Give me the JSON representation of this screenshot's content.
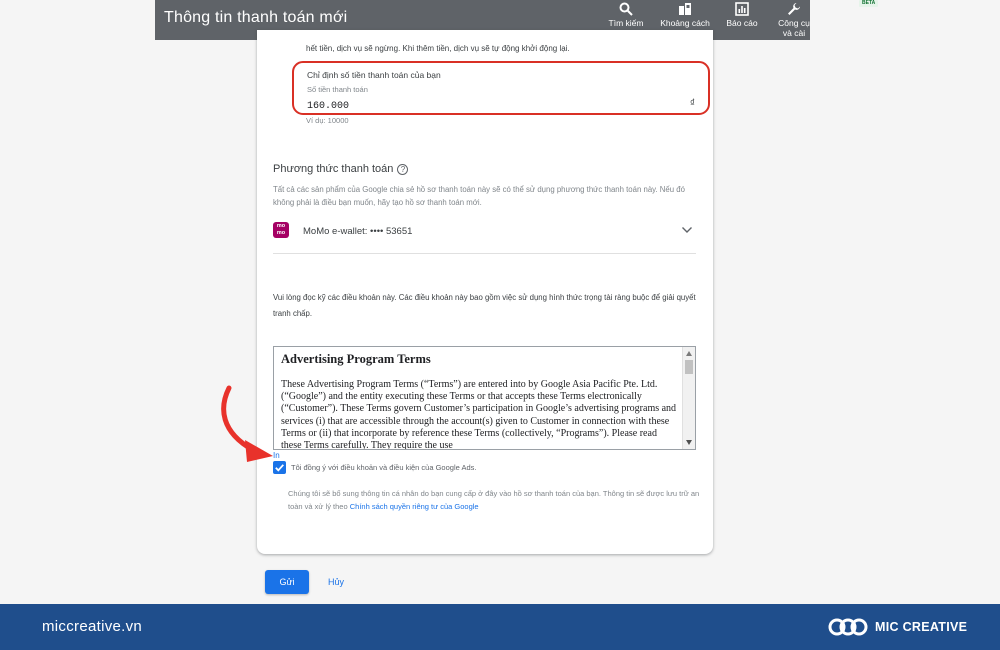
{
  "header": {
    "title": "Thông tin thanh toán mới",
    "beta": "BETA",
    "tools": [
      {
        "label": "Tìm kiếm",
        "icon": "search-icon"
      },
      {
        "label": "Khoảng cách",
        "icon": "distance-icon"
      },
      {
        "label": "Báo cáo",
        "icon": "reports-icon"
      },
      {
        "label": "Công cụ và cài",
        "icon": "wrench-icon"
      }
    ]
  },
  "budget": {
    "stop_note": "hết tiền, dịch vụ sẽ ngừng. Khi thêm tiền, dịch vụ sẽ tự động khởi động lại.",
    "label": "Chỉ định số tiền thanh toán của bạn",
    "field_label": "Số tiền thanh toán",
    "amount_value": "160.000",
    "currency": "₫",
    "example": "Ví dụ: 10000"
  },
  "payment_method": {
    "title": "Phương thức thanh toán",
    "help": "?",
    "description": "Tất cả các sản phẩm của Google chia sẻ hồ sơ thanh toán này sẽ có thể sử dụng phương thức thanh toán này. Nếu đó không phải là điều bạn muốn, hãy tạo hồ sơ thanh toán mới.",
    "logo_text": "mo mo",
    "selected": "MoMo e-wallet: •••• 53651"
  },
  "terms": {
    "intro": "Vui lòng đọc kỹ các điều khoản này. Các điều khoản này bao gồm việc sử dụng hình thức trọng tài ràng buộc để giải quyết tranh chấp.",
    "heading": "Advertising Program Terms",
    "body": "These Advertising Program Terms (“Terms”) are entered into by Google Asia Pacific Pte. Ltd. (“Google”) and the entity executing these Terms or that accepts these Terms electronically (“Customer”). These Terms govern Customer’s participation in Google’s advertising programs and services (i) that are accessible through the account(s) given to Customer in connection with these Terms or (ii) that incorporate by reference these Terms (collectively, “Programs”). Please read these Terms carefully. They require the use",
    "print_link": "In",
    "agree_text": "Tôi đồng ý với điều khoản và điều kiện của Google Ads.",
    "agree_checked": true,
    "privacy_text": "Chúng tôi sẽ bổ sung thông tin cá nhân do bạn cung cấp ở đây vào hồ sơ thanh toán của bạn. Thông tin sẽ được lưu trữ an toàn và xử lý theo ",
    "privacy_link": "Chính sách quyền riêng tư của Google"
  },
  "actions": {
    "submit": "Gửi",
    "cancel": "Hủy"
  },
  "footer": {
    "site": "miccreative.vn",
    "brand": "MIC CREATIVE"
  },
  "colors": {
    "header_bg": "#5f6368",
    "accent": "#1a73e8",
    "highlight_border": "#d93025",
    "momo": "#a50064",
    "footer_bg": "#1f4e8c"
  }
}
